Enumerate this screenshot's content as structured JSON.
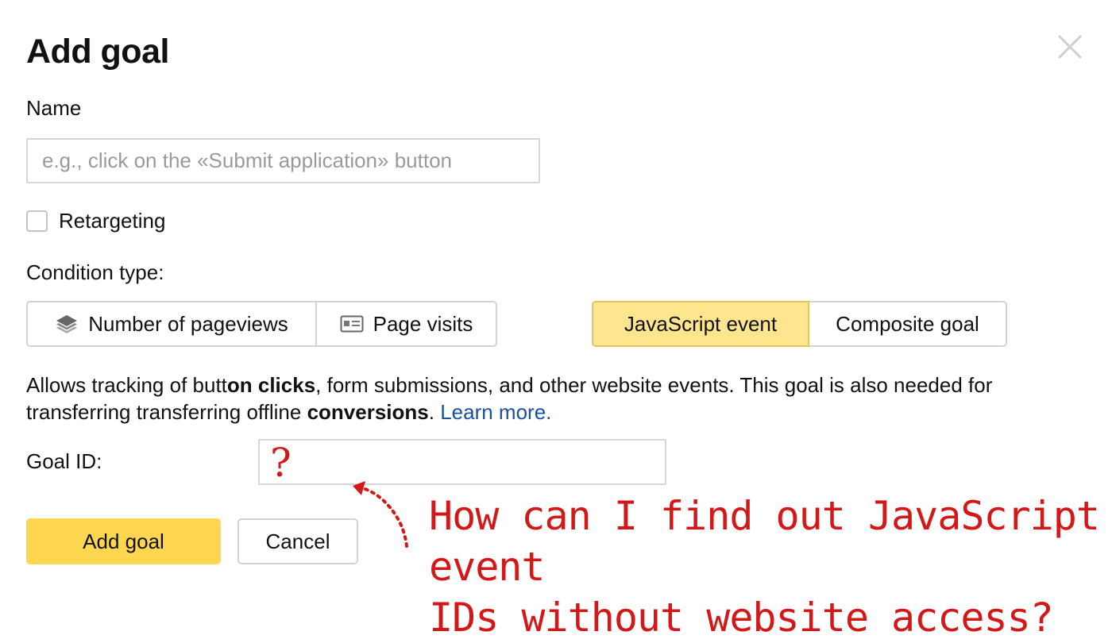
{
  "dialog": {
    "title": "Add goal",
    "close_icon": "close-icon"
  },
  "name": {
    "label": "Name",
    "value": "",
    "placeholder": "e.g., click on the «Submit application» button"
  },
  "retargeting": {
    "label": "Retargeting",
    "checked": false
  },
  "condition_type": {
    "label": "Condition type:",
    "options": [
      {
        "label": "Number of pageviews",
        "icon": "layers-icon",
        "active": false
      },
      {
        "label": "Page visits",
        "icon": "id-card-icon",
        "active": false
      },
      {
        "label": "JavaScript event",
        "icon": "",
        "active": true
      },
      {
        "label": "Composite goal",
        "icon": "",
        "active": false
      }
    ]
  },
  "description": {
    "part1": "Allows tracking of butt",
    "bold1": "on clicks",
    "part2": ", form submissions, and other website events. This goal is also needed for transferring transferring offline ",
    "bold2": "conversions",
    "part3": ". ",
    "link": "Learn more."
  },
  "goal_id": {
    "label": "Goal ID:",
    "value": ""
  },
  "buttons": {
    "add_goal": "Add goal",
    "cancel": "Cancel"
  },
  "annotation": {
    "question_mark": "?",
    "line1": "How can I find out JavaScript event",
    "line2": "IDs without website access?",
    "color": "#d41818"
  },
  "colors": {
    "primary_button": "#ffd64f",
    "active_segment": "#ffe58e",
    "link": "#1a4fa3"
  }
}
